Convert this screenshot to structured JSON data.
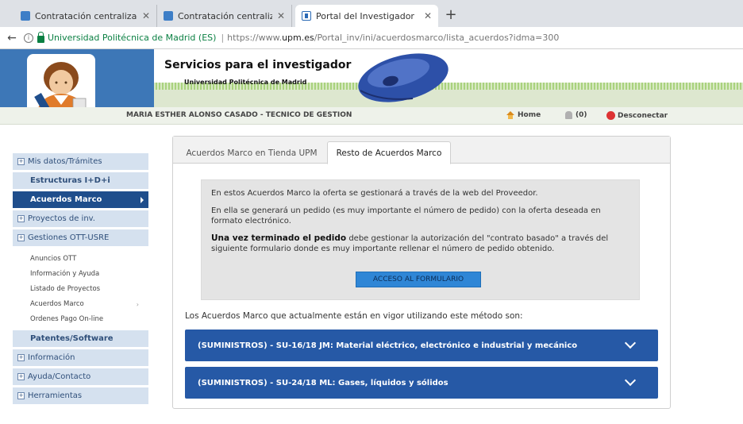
{
  "browser": {
    "tabs": [
      {
        "title": "Contratación centralizada..."
      },
      {
        "title": "Contratación centralizada..."
      },
      {
        "title": "Portal del Investigador"
      }
    ],
    "close_glyph": "✕",
    "new_tab_glyph": "+",
    "back_glyph": "←",
    "info_glyph": "i",
    "address": {
      "secure_label": "Universidad Politécnica de Madrid (ES)",
      "separator": "|",
      "url_prefix": "https://www.",
      "url_domain": "upm.es",
      "url_path": "/Portal_inv/ini/acuerdosmarco/lista_acuerdos?idma=300"
    }
  },
  "header": {
    "title": "Servicios para el investigador",
    "subtitle": "Universidad Politécnica de Madrid"
  },
  "userbar": {
    "user_name": "MARIA ESTHER ALONSO CASADO - TECNICO DE GESTION",
    "home_label": "Home",
    "notifications_label": "(0)",
    "logout_label": "Desconectar"
  },
  "sidebar": {
    "box_glyph": "+",
    "items": [
      {
        "label": "Mis datos/Trámites"
      },
      {
        "label": "Estructuras I+D+i"
      },
      {
        "label": "Acuerdos Marco"
      },
      {
        "label": "Proyectos de inv."
      },
      {
        "label": "Gestiones OTT-USRE"
      },
      {
        "label": "Patentes/Software"
      },
      {
        "label": "Información"
      },
      {
        "label": "Ayuda/Contacto"
      },
      {
        "label": "Herramientas"
      }
    ],
    "subitems": [
      {
        "label": "Anuncios OTT"
      },
      {
        "label": "Información y Ayuda"
      },
      {
        "label": "Listado de Proyectos"
      },
      {
        "label": "Acuerdos Marco"
      },
      {
        "label": "Ordenes Pago On-line"
      }
    ],
    "sub_chevron_glyph": "›"
  },
  "content": {
    "tabs": [
      {
        "label": "Acuerdos Marco en Tienda UPM"
      },
      {
        "label": "Resto de Acuerdos Marco"
      }
    ],
    "info": {
      "p1": "En estos Acuerdos Marco la oferta se gestionará a través de la web del Proveedor.",
      "p2": "En ella se generará un pedido (es muy importante el número de pedido) con la oferta deseada en formato electrónico.",
      "p3_strong": "Una vez terminado el pedido",
      "p3_rest": " debe gestionar la autorización del \"contrato basado\" a través del siguiente formulario donde es muy importante rellenar el número de pedido obtenido.",
      "button_label": "ACCESO AL FORMULARIO"
    },
    "vigor_text": "Los Acuerdos Marco que actualmente están en vigor utilizando este método son:",
    "accordions": [
      {
        "label": "(SUMINISTROS) - SU-16/18 JM: Material eléctrico, electrónico e industrial y mecánico"
      },
      {
        "label": "(SUMINISTROS) - SU-24/18 ML: Gases, líquidos y sólidos"
      }
    ]
  }
}
